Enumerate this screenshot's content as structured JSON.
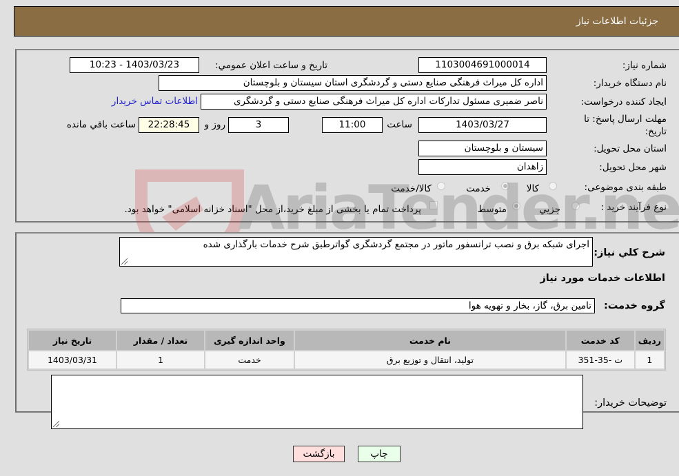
{
  "header": {
    "title": "جزئیات اطلاعات نیاز"
  },
  "form": {
    "need_number": {
      "label": "شماره نیاز:",
      "value": "1103004691000014"
    },
    "announce_datetime": {
      "label": "تاریخ و ساعت اعلان عمومي:",
      "value": "1403/03/23 - 10:23"
    },
    "buyer_org": {
      "label": "نام دستگاه خریدار:",
      "value": "اداره کل میراث فرهنگی  صنایع دستی و گردشگری استان سیستان و بلوچستان"
    },
    "requester": {
      "label": "ایجاد کننده درخواست:",
      "value": "ناصر ضمیری مسئول تدارکات اداره کل میراث فرهنگی  صنایع دستی و گردشگری"
    },
    "buyer_contact_link": "اطلاعات تماس خریدار",
    "deadline": {
      "label": "مهلت ارسال پاسخ: تا تاریخ:",
      "date": "1403/03/27",
      "time_label": "ساعت",
      "time": "11:00",
      "days": "3",
      "days_label": "روز و",
      "remaining": "22:28:45",
      "remaining_label": "ساعت باقي مانده"
    },
    "province": {
      "label": "استان محل تحویل:",
      "value": "سیستان و بلوچستان"
    },
    "city": {
      "label": "شهر محل تحویل:",
      "value": "زاهدان"
    },
    "category": {
      "label": "طبقه بندی موضوعی:",
      "options": [
        "کالا",
        "خدمت",
        "کالا/خدمت"
      ],
      "selected": "خدمت"
    },
    "purchase_type": {
      "label": "نوع فرآیند خرید :",
      "options": [
        "جزیي",
        "متوسط"
      ],
      "selected": "متوسط",
      "treasury_note": "پرداخت تمام یا بخشی از مبلغ خرید،از محل \"اسناد خزانه اسلامی\" خواهد بود."
    }
  },
  "details": {
    "description_label": "شرح کلي نیاز:",
    "description": "اجرای شبکه برق و نصب ترانسفور ماتور در مجتمع گردشگری گواترطبق شرح خدمات بارگذاری شده",
    "services_heading": "اطلاعات خدمات مورد نیاز",
    "service_group_label": "گروه خدمت:",
    "service_group": "تامین برق، گاز، بخار و تهویه هوا",
    "table": {
      "headers": [
        "ردیف",
        "کد خدمت",
        "نام خدمت",
        "واحد اندازه گیری",
        "تعداد / مقدار",
        "تاریخ نیاز"
      ],
      "rows": [
        [
          "1",
          "ت -35-351",
          "تولید، انتقال و توزیع برق",
          "خدمت",
          "1",
          "1403/03/31"
        ]
      ]
    },
    "buyer_notes_label": "توضیحات خریدار:",
    "buyer_notes": ""
  },
  "buttons": {
    "print": "چاپ",
    "back": "بازگشت"
  },
  "watermark": "AriaTender.neT",
  "colors": {
    "header_bg": "#8b6d43",
    "print_bg": "#eaffea",
    "back_bg": "#ffdede",
    "link": "#2222cc"
  }
}
